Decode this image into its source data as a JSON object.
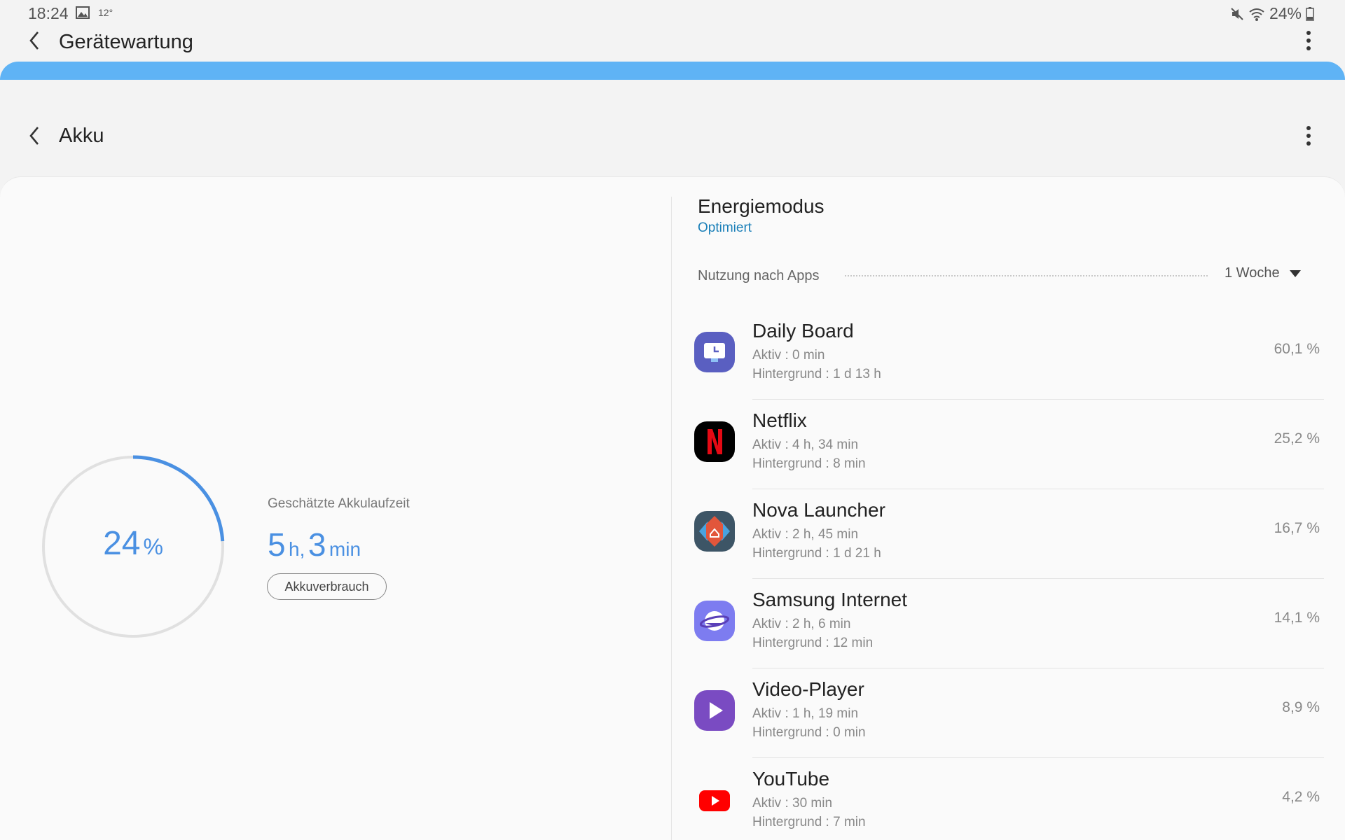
{
  "status_bar": {
    "time": "18:24",
    "temperature": "12°",
    "battery": "24%"
  },
  "header": {
    "title": "Gerätewartung"
  },
  "subheader": {
    "title": "Akku"
  },
  "battery": {
    "level_percent": 24,
    "level_text": "24",
    "percent_sign": "%",
    "estimate_label": "Geschätzte Akkulaufzeit",
    "hours": "5",
    "hours_unit": "h,",
    "minutes": "3",
    "minutes_unit": "min",
    "usage_button": "Akkuverbrauch"
  },
  "power_mode": {
    "title": "Energiemodus",
    "value": "Optimiert"
  },
  "usage": {
    "label": "Nutzung nach Apps",
    "period": "1 Woche"
  },
  "apps": [
    {
      "name": "Daily Board",
      "active": "Aktiv : 0 min",
      "background": "Hintergrund : 1 d 13 h",
      "percent": "60,1 %",
      "icon": "daily-board-icon"
    },
    {
      "name": "Netflix",
      "active": "Aktiv : 4 h, 34 min",
      "background": "Hintergrund : 8 min",
      "percent": "25,2 %",
      "icon": "netflix-icon"
    },
    {
      "name": "Nova Launcher",
      "active": "Aktiv : 2 h, 45 min",
      "background": "Hintergrund : 1 d 21 h",
      "percent": "16,7 %",
      "icon": "nova-launcher-icon"
    },
    {
      "name": "Samsung Internet",
      "active": "Aktiv : 2 h, 6 min",
      "background": "Hintergrund : 12 min",
      "percent": "14,1 %",
      "icon": "samsung-internet-icon"
    },
    {
      "name": "Video-Player",
      "active": "Aktiv : 1 h, 19 min",
      "background": "Hintergrund : 0 min",
      "percent": "8,9 %",
      "icon": "video-player-icon"
    },
    {
      "name": "YouTube",
      "active": "Aktiv : 30 min",
      "background": "Hintergrund : 7 min",
      "percent": "4,2 %",
      "icon": "youtube-icon"
    }
  ],
  "colors": {
    "accent": "#4a90e2",
    "header_strip": "#5fb3f5",
    "link": "#1a7fb8"
  }
}
